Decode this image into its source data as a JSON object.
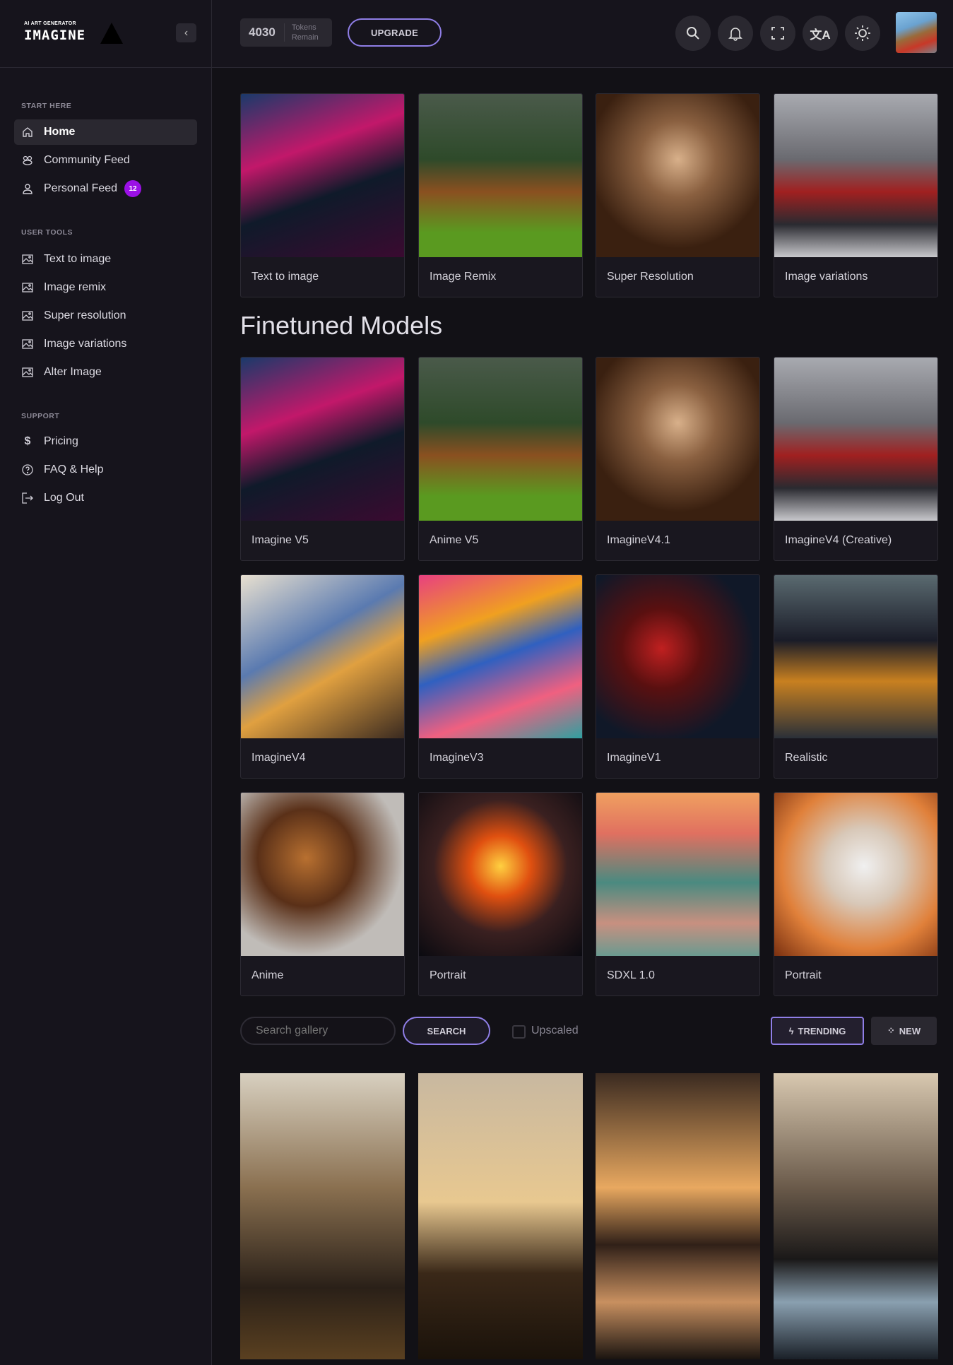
{
  "logo": {
    "tagline": "AI ART GENERATOR",
    "name": "IMAGINE"
  },
  "header": {
    "tokens": "4030",
    "tokens_label_1": "Tokens",
    "tokens_label_2": "Remain",
    "upgrade": "UPGRADE"
  },
  "sidebar": {
    "sections": [
      {
        "title": "START HERE",
        "items": [
          {
            "label": "Home",
            "icon": "home-icon",
            "active": true
          },
          {
            "label": "Community Feed",
            "icon": "community-icon"
          },
          {
            "label": "Personal Feed",
            "icon": "user-icon",
            "badge": "12"
          }
        ]
      },
      {
        "title": "USER TOOLS",
        "items": [
          {
            "label": "Text to image",
            "icon": "image-icon"
          },
          {
            "label": "Image remix",
            "icon": "image-icon"
          },
          {
            "label": "Super resolution",
            "icon": "image-icon"
          },
          {
            "label": "Image variations",
            "icon": "image-icon"
          },
          {
            "label": "Alter Image",
            "icon": "image-icon"
          }
        ]
      },
      {
        "title": "SUPPORT",
        "items": [
          {
            "label": "Pricing",
            "icon": "dollar-icon"
          },
          {
            "label": "FAQ & Help",
            "icon": "help-icon"
          },
          {
            "label": "Log Out",
            "icon": "logout-icon"
          }
        ]
      }
    ]
  },
  "tools": [
    "Text to image",
    "Image Remix",
    "Super Resolution",
    "Image variations"
  ],
  "finetuned_title": "Finetuned Models",
  "models": [
    "Imagine V5",
    "Anime V5",
    "ImagineV4.1",
    "ImagineV4 (Creative)",
    "ImagineV4",
    "ImagineV3",
    "ImagineV1",
    "Realistic",
    "Anime",
    "Portrait",
    "SDXL 1.0",
    "Portrait"
  ],
  "gallery": {
    "search_placeholder": "Search gallery",
    "search_button": "SEARCH",
    "upscaled_label": "Upscaled",
    "trending": "TRENDING",
    "new": "NEW"
  }
}
